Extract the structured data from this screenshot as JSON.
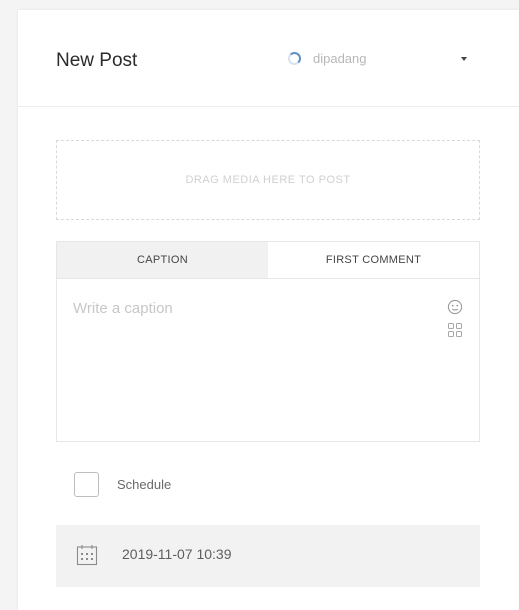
{
  "header": {
    "title": "New Post",
    "account_name": "dipadang"
  },
  "media": {
    "drop_label": "DRAG MEDIA HERE TO POST"
  },
  "tabs": [
    {
      "label": "CAPTION",
      "active": true
    },
    {
      "label": "FIRST COMMENT",
      "active": false
    }
  ],
  "caption": {
    "placeholder": "Write a caption"
  },
  "icons": {
    "spinner": "loading-spinner-icon",
    "dropdown": "caret-down-icon",
    "emoji": "emoji-icon",
    "grid": "grid-icon",
    "calendar": "calendar-icon"
  },
  "schedule": {
    "label": "Schedule",
    "checked": false,
    "datetime": "2019-11-07 10:39"
  },
  "colors": {
    "accent": "#5d8fc8",
    "tab_active_bg": "#f1f1f1",
    "datetime_bg": "#f2f2f2"
  }
}
